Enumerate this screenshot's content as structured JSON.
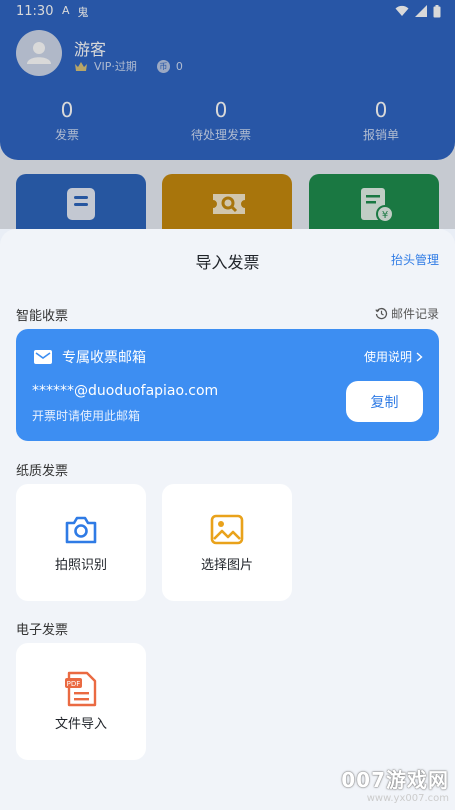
{
  "status": {
    "time": "11:30",
    "left_icons": [
      "A",
      "鬼"
    ]
  },
  "profile": {
    "name": "游客",
    "vip": "VIP·过期",
    "coin_icon": "币",
    "coins": "0"
  },
  "stats": [
    {
      "value": "0",
      "label": "发票"
    },
    {
      "value": "0",
      "label": "待处理发票"
    },
    {
      "value": "0",
      "label": "报销单"
    }
  ],
  "tiles": [
    {
      "color": "#2d66bd"
    },
    {
      "color": "#c68a0f"
    },
    {
      "color": "#1f8e4e"
    }
  ],
  "sheet": {
    "title": "导入发票",
    "header_management": "抬头管理"
  },
  "smart": {
    "label": "智能收票",
    "mail_log": "邮件记录"
  },
  "email_card": {
    "title": "专属收票邮箱",
    "instructions": "使用说明",
    "address": "******@duoduofapiao.com",
    "hint": "开票时请使用此邮箱",
    "copy_label": "复制",
    "color": "#3d8ef2"
  },
  "paper": {
    "label": "纸质发票",
    "items": [
      {
        "label": "拍照识别",
        "icon": "camera-icon"
      },
      {
        "label": "选择图片",
        "icon": "image-icon"
      }
    ]
  },
  "electronic": {
    "label": "电子发票",
    "items": [
      {
        "label": "文件导入",
        "icon": "pdf-file-icon",
        "badge": "PDF"
      }
    ]
  },
  "watermark": {
    "big": "007游戏网",
    "small": "www.yx007.com"
  }
}
